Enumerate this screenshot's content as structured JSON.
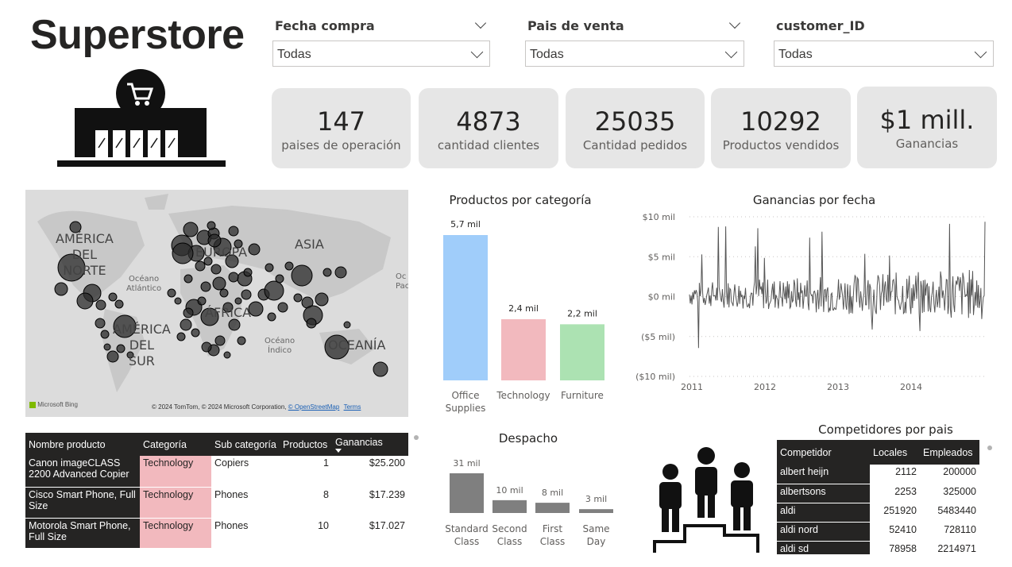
{
  "title": "Superstore",
  "slicers": [
    {
      "label": "Fecha compra",
      "value": "Todas"
    },
    {
      "label": "Pais de venta",
      "value": "Todas"
    },
    {
      "label": "customer_ID",
      "value": "Todas"
    }
  ],
  "kpis": [
    {
      "value": "147",
      "label": "paises de operación"
    },
    {
      "value": "4873",
      "label": "cantidad clientes"
    },
    {
      "value": "25035",
      "label": "Cantidad pedidos"
    },
    {
      "value": "10292",
      "label": "Productos vendidos"
    },
    {
      "value": "$1 mill.",
      "label": "Ganancias"
    }
  ],
  "map": {
    "labels": {
      "america_norte": [
        "AMÉRICA",
        "DEL",
        "NORTE"
      ],
      "america_sur": [
        "AMÉRICA",
        "DEL",
        "SUR"
      ],
      "europa": "EUROPA",
      "asia": "ASIA",
      "africa": "ÁFRICA",
      "oceania": "OCEANÍA",
      "oceano_atlantico": [
        "Océano",
        "Atlántico"
      ],
      "oceano_indico": [
        "Océano",
        "Índico"
      ],
      "oceano_pacifico": [
        "Oc",
        "Pac"
      ]
    },
    "bing_logo": "Microsoft Bing",
    "copyright": "© 2024 TomTom, © 2024 Microsoft Corporation,",
    "osm_link": "© OpenStreetMap",
    "terms_link": "Terms"
  },
  "chart_data": [
    {
      "type": "bar",
      "title": "Productos por categoría",
      "categories": [
        "Office Supplies",
        "Technology",
        "Furniture"
      ],
      "category_lines": [
        [
          "Office",
          "Supplies"
        ],
        [
          "Technology"
        ],
        [
          "Furniture"
        ]
      ],
      "values": [
        5700,
        2400,
        2200
      ],
      "data_labels": [
        "5,7 mil",
        "2,4 mil",
        "2,2 mil"
      ],
      "colors": [
        "#a0cdfa",
        "#f2b9be",
        "#ace2b2"
      ]
    },
    {
      "type": "line",
      "title": "Ganancias por fecha",
      "y_ticks": [
        "$10 mil",
        "$5 mil",
        "$0 mil",
        "($5 mil)",
        "($10 mil)"
      ],
      "y_tick_values": [
        10000,
        5000,
        0,
        -5000,
        -10000
      ],
      "x_ticks": [
        "2011",
        "2012",
        "2013",
        "2014"
      ],
      "ylim": [
        -10000,
        10000
      ],
      "color": "#555555"
    },
    {
      "type": "bar",
      "title": "Despacho",
      "categories": [
        "Standard Class",
        "Second Class",
        "First Class",
        "Same Day"
      ],
      "category_lines": [
        [
          "Standard",
          "Class"
        ],
        [
          "Second",
          "Class"
        ],
        [
          "First",
          "Class"
        ],
        [
          "Same",
          "Day"
        ]
      ],
      "values": [
        31000,
        10000,
        8000,
        3000
      ],
      "data_labels": [
        "31 mil",
        "10 mil",
        "8 mil",
        "3 mil"
      ],
      "color": "#7f7f7f"
    }
  ],
  "products_table": {
    "headers": [
      "Nombre producto",
      "Categoría",
      "Sub categoría",
      "Productos",
      "Ganancias"
    ],
    "rows": [
      {
        "name": "Canon imageCLASS 2200 Advanced Copier",
        "category": "Technology",
        "subcategory": "Copiers",
        "products": "1",
        "profit": "$25.200"
      },
      {
        "name": "Cisco Smart Phone, Full Size",
        "category": "Technology",
        "subcategory": "Phones",
        "products": "8",
        "profit": "$17.239"
      },
      {
        "name": "Motorola Smart Phone, Full Size",
        "category": "Technology",
        "subcategory": "Phones",
        "products": "10",
        "profit": "$17.027"
      }
    ]
  },
  "competitors": {
    "title": "Competidores por pais",
    "headers": [
      "Competidor",
      "Locales",
      "Empleados"
    ],
    "rows": [
      {
        "name": "albert heijn",
        "stores": "2112",
        "employees": "200000"
      },
      {
        "name": "albertsons",
        "stores": "2253",
        "employees": "325000"
      },
      {
        "name": "aldi",
        "stores": "251920",
        "employees": "5483440"
      },
      {
        "name": "aldi nord",
        "stores": "52410",
        "employees": "728110"
      },
      {
        "name": "aldi sd",
        "stores": "78958",
        "employees": "2214971"
      }
    ]
  }
}
